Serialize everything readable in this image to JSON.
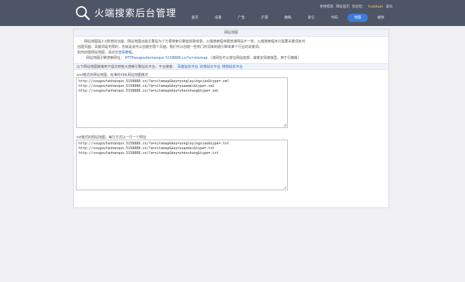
{
  "header": {
    "title": "火端搜索后台管理",
    "user": {
      "prefix": "使用帮助",
      "home": "网站首页",
      "welcome": "欢迎您：",
      "username": "huoduan",
      "logout": "退出"
    },
    "nav": [
      "首页",
      "设置",
      "广告",
      "扩展",
      "蜘蛛",
      "其它",
      "代码",
      "地图",
      "缓存"
    ],
    "active_nav": "地图"
  },
  "panel": {
    "title": "网站地图",
    "intro_line1": "网站地图是2.X新增的功能，网站地图功能主要是为了方便搜索引擎能抓取收录。火端搜索程序跟普通网站不一样，火端搜索程序只需要关键词就可",
    "intro_line2": "创建页面，关键词是无限的，也就是说可以创建无限个页面。我们可以创建一些热门的词来刺激引擎来某个行业的关键词。",
    "intro_line3_prefix": "如何创建网站地图，请点击",
    "intro_line3_link": "查看教程",
    "intro_line3_suffix": "。",
    "addr_prefix": "网站地图引擎搜索网址：",
    "addr_url": "HTTPsougoufanhanqun.5158888.cn/?a=sitemap",
    "addr_note": "（该网址可以放在网站底部，或者友情链接里，用于引蜘蛛）",
    "submit_prefix": "以下网站地图链接用于提交到各大搜索引擎站长平台，平台链接：",
    "submit_links": [
      "百度站长平台",
      "好搜站长平台",
      "搜狗站长平台"
    ],
    "xml_label": "xml格式的网站地图，标准的XML网站地图格式",
    "xml_lines": [
      "http://sougoufanhanqun.5158888.cn/?a=sitemap&key=yongleyingxiao&type=.xml",
      "http://sougoufanhanqun.5158888.cn/?a=sitemap&key=yuanmei&type=.xml",
      "http://sougoufanhanqun.5158888.cn/?a=sitemap&key=zhenshang&type=.xml"
    ],
    "txt_label": "txt格式的网站地图，每行方式以一行一个网址",
    "txt_lines": [
      "http://sougoufanhanqun.5158888.cn/?a=sitemap&key=yongleyingxiao&type=.txt",
      "http://sougoufanhanqun.5158888.cn/?a=sitemap&key=yuanmei&type=.txt",
      "http://sougoufanhanqun.5158888.cn/?a=sitemap&key=zhenshang&type=.txt"
    ]
  }
}
